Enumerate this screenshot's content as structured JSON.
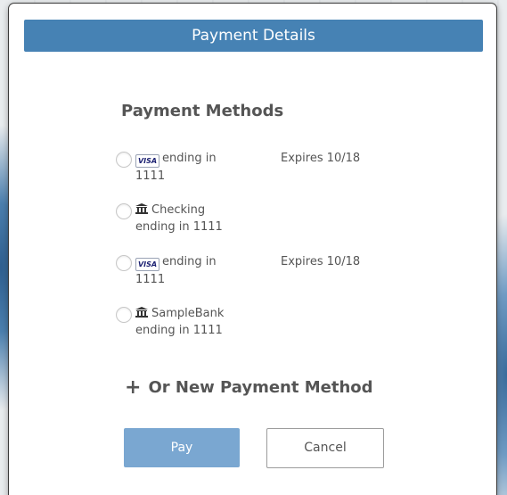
{
  "modal": {
    "title": "Payment Details"
  },
  "payment_methods": {
    "heading": "Payment Methods",
    "items": [
      {
        "type": "card",
        "icon": "visa-icon",
        "brand": "VISA",
        "line1": "ending in",
        "line2": "1111",
        "expires": "Expires 10/18"
      },
      {
        "type": "bank",
        "icon": "bank-icon",
        "line1": "Checking",
        "line2": "ending in 1111",
        "expires": ""
      },
      {
        "type": "card",
        "icon": "visa-icon",
        "brand": "VISA",
        "line1": "ending in",
        "line2": "1111",
        "expires": "Expires 10/18"
      },
      {
        "type": "bank",
        "icon": "bank-icon",
        "line1": "SampleBank",
        "line2": "ending in 1111",
        "expires": ""
      }
    ]
  },
  "new_method": {
    "label": "Or New Payment Method",
    "icon": "plus-icon"
  },
  "actions": {
    "pay_label": "Pay",
    "cancel_label": "Cancel"
  },
  "colors": {
    "header_bg": "#4682b4",
    "pay_button_bg": "#7aa7d1",
    "text": "#555555"
  }
}
